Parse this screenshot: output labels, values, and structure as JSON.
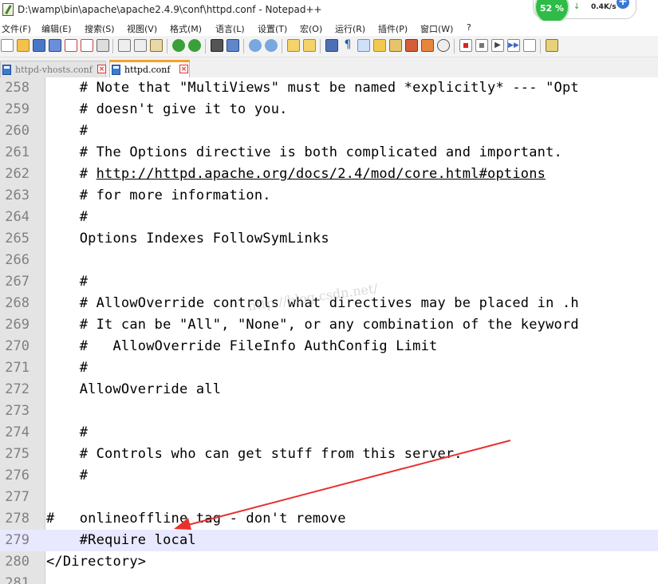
{
  "window": {
    "title": "D:\\wamp\\bin\\apache\\apache2.4.9\\conf\\httpd.conf - Notepad++"
  },
  "net_widget": {
    "cpu_percent": "52 %",
    "download_speed": "0.4K/s",
    "plus_label": "+"
  },
  "menu": [
    {
      "label": "文件(F)"
    },
    {
      "label": "编辑(E)"
    },
    {
      "label": "搜索(S)"
    },
    {
      "label": "视图(V)"
    },
    {
      "label": "格式(M)"
    },
    {
      "label": "语言(L)"
    },
    {
      "label": "设置(T)"
    },
    {
      "label": "宏(O)"
    },
    {
      "label": "运行(R)"
    },
    {
      "label": "插件(P)"
    },
    {
      "label": "窗口(W)"
    },
    {
      "label": "?"
    }
  ],
  "toolbar_icons": [
    "new-file-icon",
    "open-file-icon",
    "save-icon",
    "save-all-icon",
    "close-icon",
    "close-all-icon",
    "print-icon",
    "cut-icon",
    "copy-icon",
    "paste-icon",
    "undo-icon",
    "redo-icon",
    "find-icon",
    "replace-icon",
    "zoom-in-icon",
    "zoom-out-icon",
    "sync-vertical-icon",
    "sync-horizontal-icon",
    "word-wrap-icon",
    "show-all-chars-icon",
    "indent-guide-icon",
    "user-language-icon",
    "doc-map-icon",
    "function-list-icon",
    "folder-workspace-icon",
    "monitoring-icon",
    "record-macro-icon",
    "stop-macro-icon",
    "play-macro-icon",
    "run-macro-multiple-icon",
    "save-macro-icon",
    "spell-check-icon"
  ],
  "tabs": [
    {
      "label": "httpd-vhosts.conf",
      "active": false
    },
    {
      "label": "httpd.conf",
      "active": true
    }
  ],
  "watermark": "http://blog.csdn.net/",
  "editor": {
    "current_line": "279",
    "lines": [
      {
        "num": "258",
        "text": "    # Note that \"MultiViews\" must be named *explicitly* --- \"Opt"
      },
      {
        "num": "259",
        "text": "    # doesn't give it to you."
      },
      {
        "num": "260",
        "text": "    #"
      },
      {
        "num": "261",
        "text": "    # The Options directive is both complicated and important.  "
      },
      {
        "num": "262",
        "prefix": "    # ",
        "link": "http://httpd.apache.org/docs/2.4/mod/core.html#options"
      },
      {
        "num": "263",
        "text": "    # for more information."
      },
      {
        "num": "264",
        "text": "    #"
      },
      {
        "num": "265",
        "text": "    Options Indexes FollowSymLinks"
      },
      {
        "num": "266",
        "text": ""
      },
      {
        "num": "267",
        "text": "    #"
      },
      {
        "num": "268",
        "text": "    # AllowOverride controls what directives may be placed in .h"
      },
      {
        "num": "269",
        "text": "    # It can be \"All\", \"None\", or any combination of the keyword"
      },
      {
        "num": "270",
        "text": "    #   AllowOverride FileInfo AuthConfig Limit"
      },
      {
        "num": "271",
        "text": "    #"
      },
      {
        "num": "272",
        "text": "    AllowOverride all"
      },
      {
        "num": "273",
        "text": ""
      },
      {
        "num": "274",
        "text": "    #"
      },
      {
        "num": "275",
        "text": "    # Controls who can get stuff from this server."
      },
      {
        "num": "276",
        "text": "    #"
      },
      {
        "num": "277",
        "text": ""
      },
      {
        "num": "278",
        "text": "#   onlineoffline tag - don't remove"
      },
      {
        "num": "279",
        "text": "    #Require local"
      },
      {
        "num": "280",
        "text": "</Directory>"
      },
      {
        "num": "281",
        "text": ""
      }
    ]
  },
  "annotation_arrow": {
    "color": "#e8312f",
    "points_to_line": "279"
  }
}
